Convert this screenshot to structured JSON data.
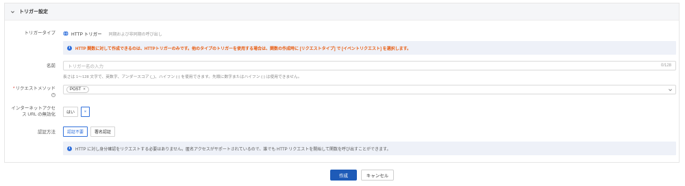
{
  "panel": {
    "title": "トリガー設定",
    "collapse_icon": "chevron-down-icon"
  },
  "trigger_type": {
    "label": "トリガータイプ",
    "icon": "globe-icon",
    "name": "HTTP トリガー",
    "description": "同期および非同期の呼び出し",
    "notice": "HTTP 関数に対して作成できるのは、HTTPトリガーのみです。他のタイプのトリガーを使用する場合は、関数の作成時に [リクエストタイプ] で [イベントリクエスト] を選択します。"
  },
  "name_field": {
    "label": "名前",
    "placeholder": "トリガー名の入力",
    "counter": "0/128",
    "hint": "長さは 1～128 文字で、英数字、アンダースコア (_)、ハイフン (-) を使用できます。先頭に数字またはハイフン (-) は使用できません。"
  },
  "request_method": {
    "required_mark": "*",
    "label": "リクエストメソッド",
    "help_icon": "?",
    "selected": "POST",
    "remove": "×"
  },
  "internet_access": {
    "label_line1": "インターネットアクセ",
    "label_line2": "ス URL の無効化",
    "options": [
      "はい",
      "×"
    ]
  },
  "auth": {
    "label": "認証方法",
    "options": [
      "認証不要",
      "署名認証"
    ],
    "notice": "HTTP に対し身分確認をリクエストする必要はありません。匿名アクセスがサポートされているので、誰でも HTTP リクエストを開始して関数を呼び出すことができます。"
  },
  "info_icon_glyph": "i",
  "footer": {
    "create": "作成",
    "cancel": "キャンセル"
  },
  "colors": {
    "accent": "#2f6fdb",
    "warning": "#e8590c",
    "primary_button": "#1e5bb8",
    "notice_bg": "#eef1f8"
  }
}
